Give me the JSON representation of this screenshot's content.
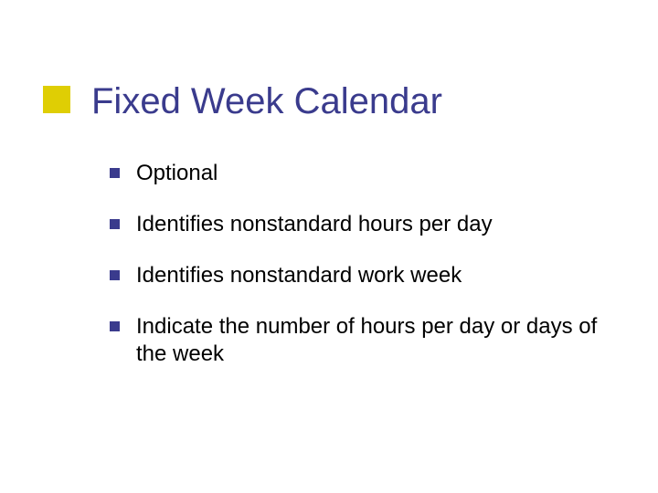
{
  "slide": {
    "title": "Fixed Week Calendar",
    "bullets": [
      "Optional",
      "Identifies nonstandard hours per day",
      "Identifies nonstandard work week",
      "Indicate the number of hours per day or days of the week"
    ]
  }
}
